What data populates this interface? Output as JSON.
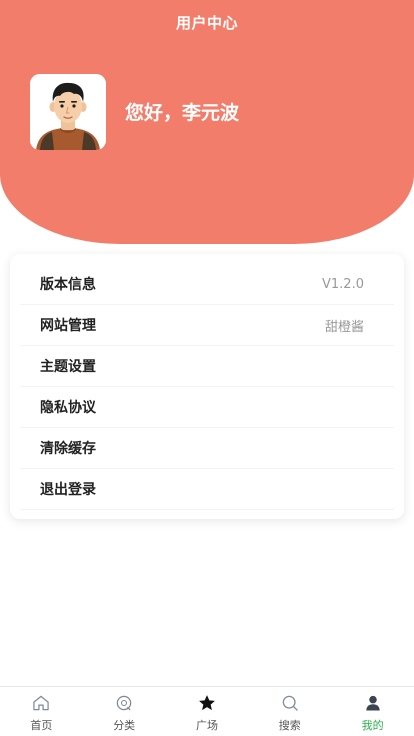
{
  "header": {
    "title": "用户中心",
    "greeting": "您好，李元波",
    "background_color": "#f27d6a"
  },
  "menu": {
    "items": [
      {
        "label": "版本信息",
        "value": "V1.2.0"
      },
      {
        "label": "网站管理",
        "value": "甜橙酱"
      },
      {
        "label": "主题设置",
        "value": ""
      },
      {
        "label": "隐私协议",
        "value": ""
      },
      {
        "label": "清除缓存",
        "value": ""
      },
      {
        "label": "退出登录",
        "value": ""
      }
    ]
  },
  "tabbar": {
    "active_color": "#2bb24c",
    "tabs": [
      {
        "label": "首页",
        "icon": "home-icon"
      },
      {
        "label": "分类",
        "icon": "category-icon"
      },
      {
        "label": "广场",
        "icon": "star-icon"
      },
      {
        "label": "搜索",
        "icon": "search-icon"
      },
      {
        "label": "我的",
        "icon": "user-icon",
        "active": true
      }
    ]
  }
}
